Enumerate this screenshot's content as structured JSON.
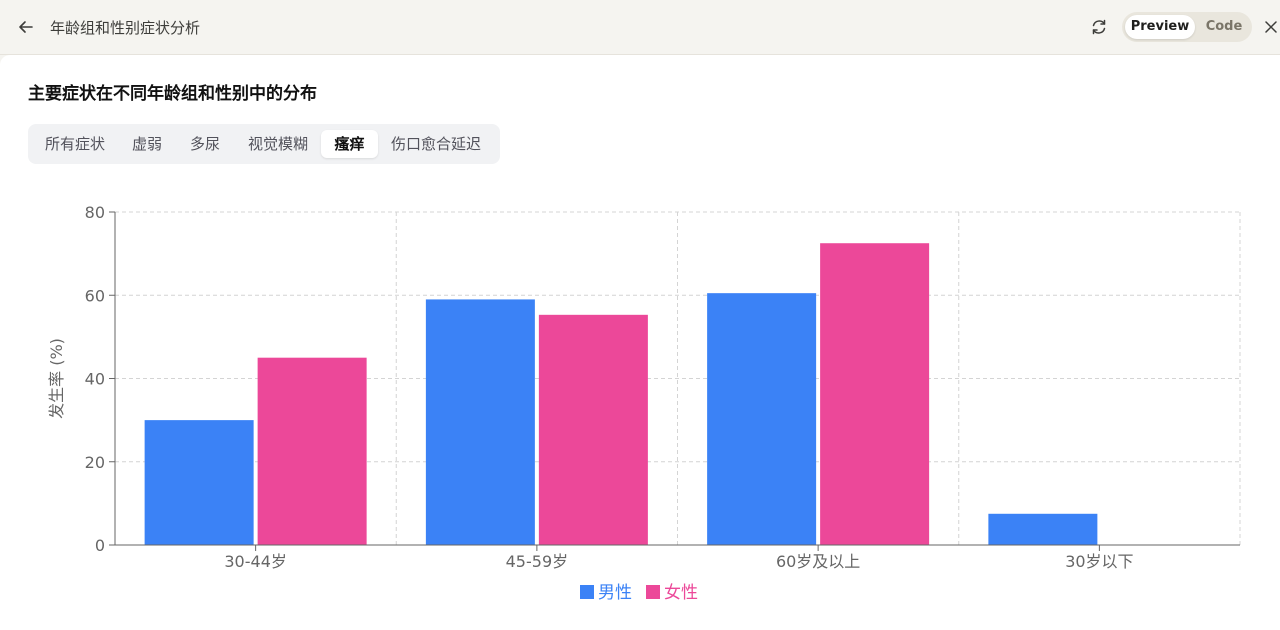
{
  "header": {
    "title": "年龄组和性别症状分析",
    "preview_label": "Preview",
    "code_label": "Code"
  },
  "main": {
    "heading": "主要症状在不同年龄组和性别中的分布",
    "tabs": [
      {
        "label": "所有症状",
        "active": false
      },
      {
        "label": "虚弱",
        "active": false
      },
      {
        "label": "多尿",
        "active": false
      },
      {
        "label": "视觉模糊",
        "active": false
      },
      {
        "label": "瘙痒",
        "active": true
      },
      {
        "label": "伤口愈合延迟",
        "active": false
      }
    ]
  },
  "chart_data": {
    "type": "bar",
    "title": "",
    "xlabel": "",
    "ylabel": "发生率 (%)",
    "categories": [
      "30-44岁",
      "45-59岁",
      "60岁及以上",
      "30岁以下"
    ],
    "series": [
      {
        "name": "男性",
        "color": "#3b82f6",
        "values": [
          30,
          59,
          60.5,
          7.5
        ]
      },
      {
        "name": "女性",
        "color": "#ec4899",
        "values": [
          45,
          55.3,
          72.5,
          0
        ]
      }
    ],
    "ylim": [
      0,
      80
    ],
    "yticks": [
      "0",
      "20",
      "40",
      "60",
      "80"
    ],
    "grid": true,
    "legend": "bottom"
  }
}
